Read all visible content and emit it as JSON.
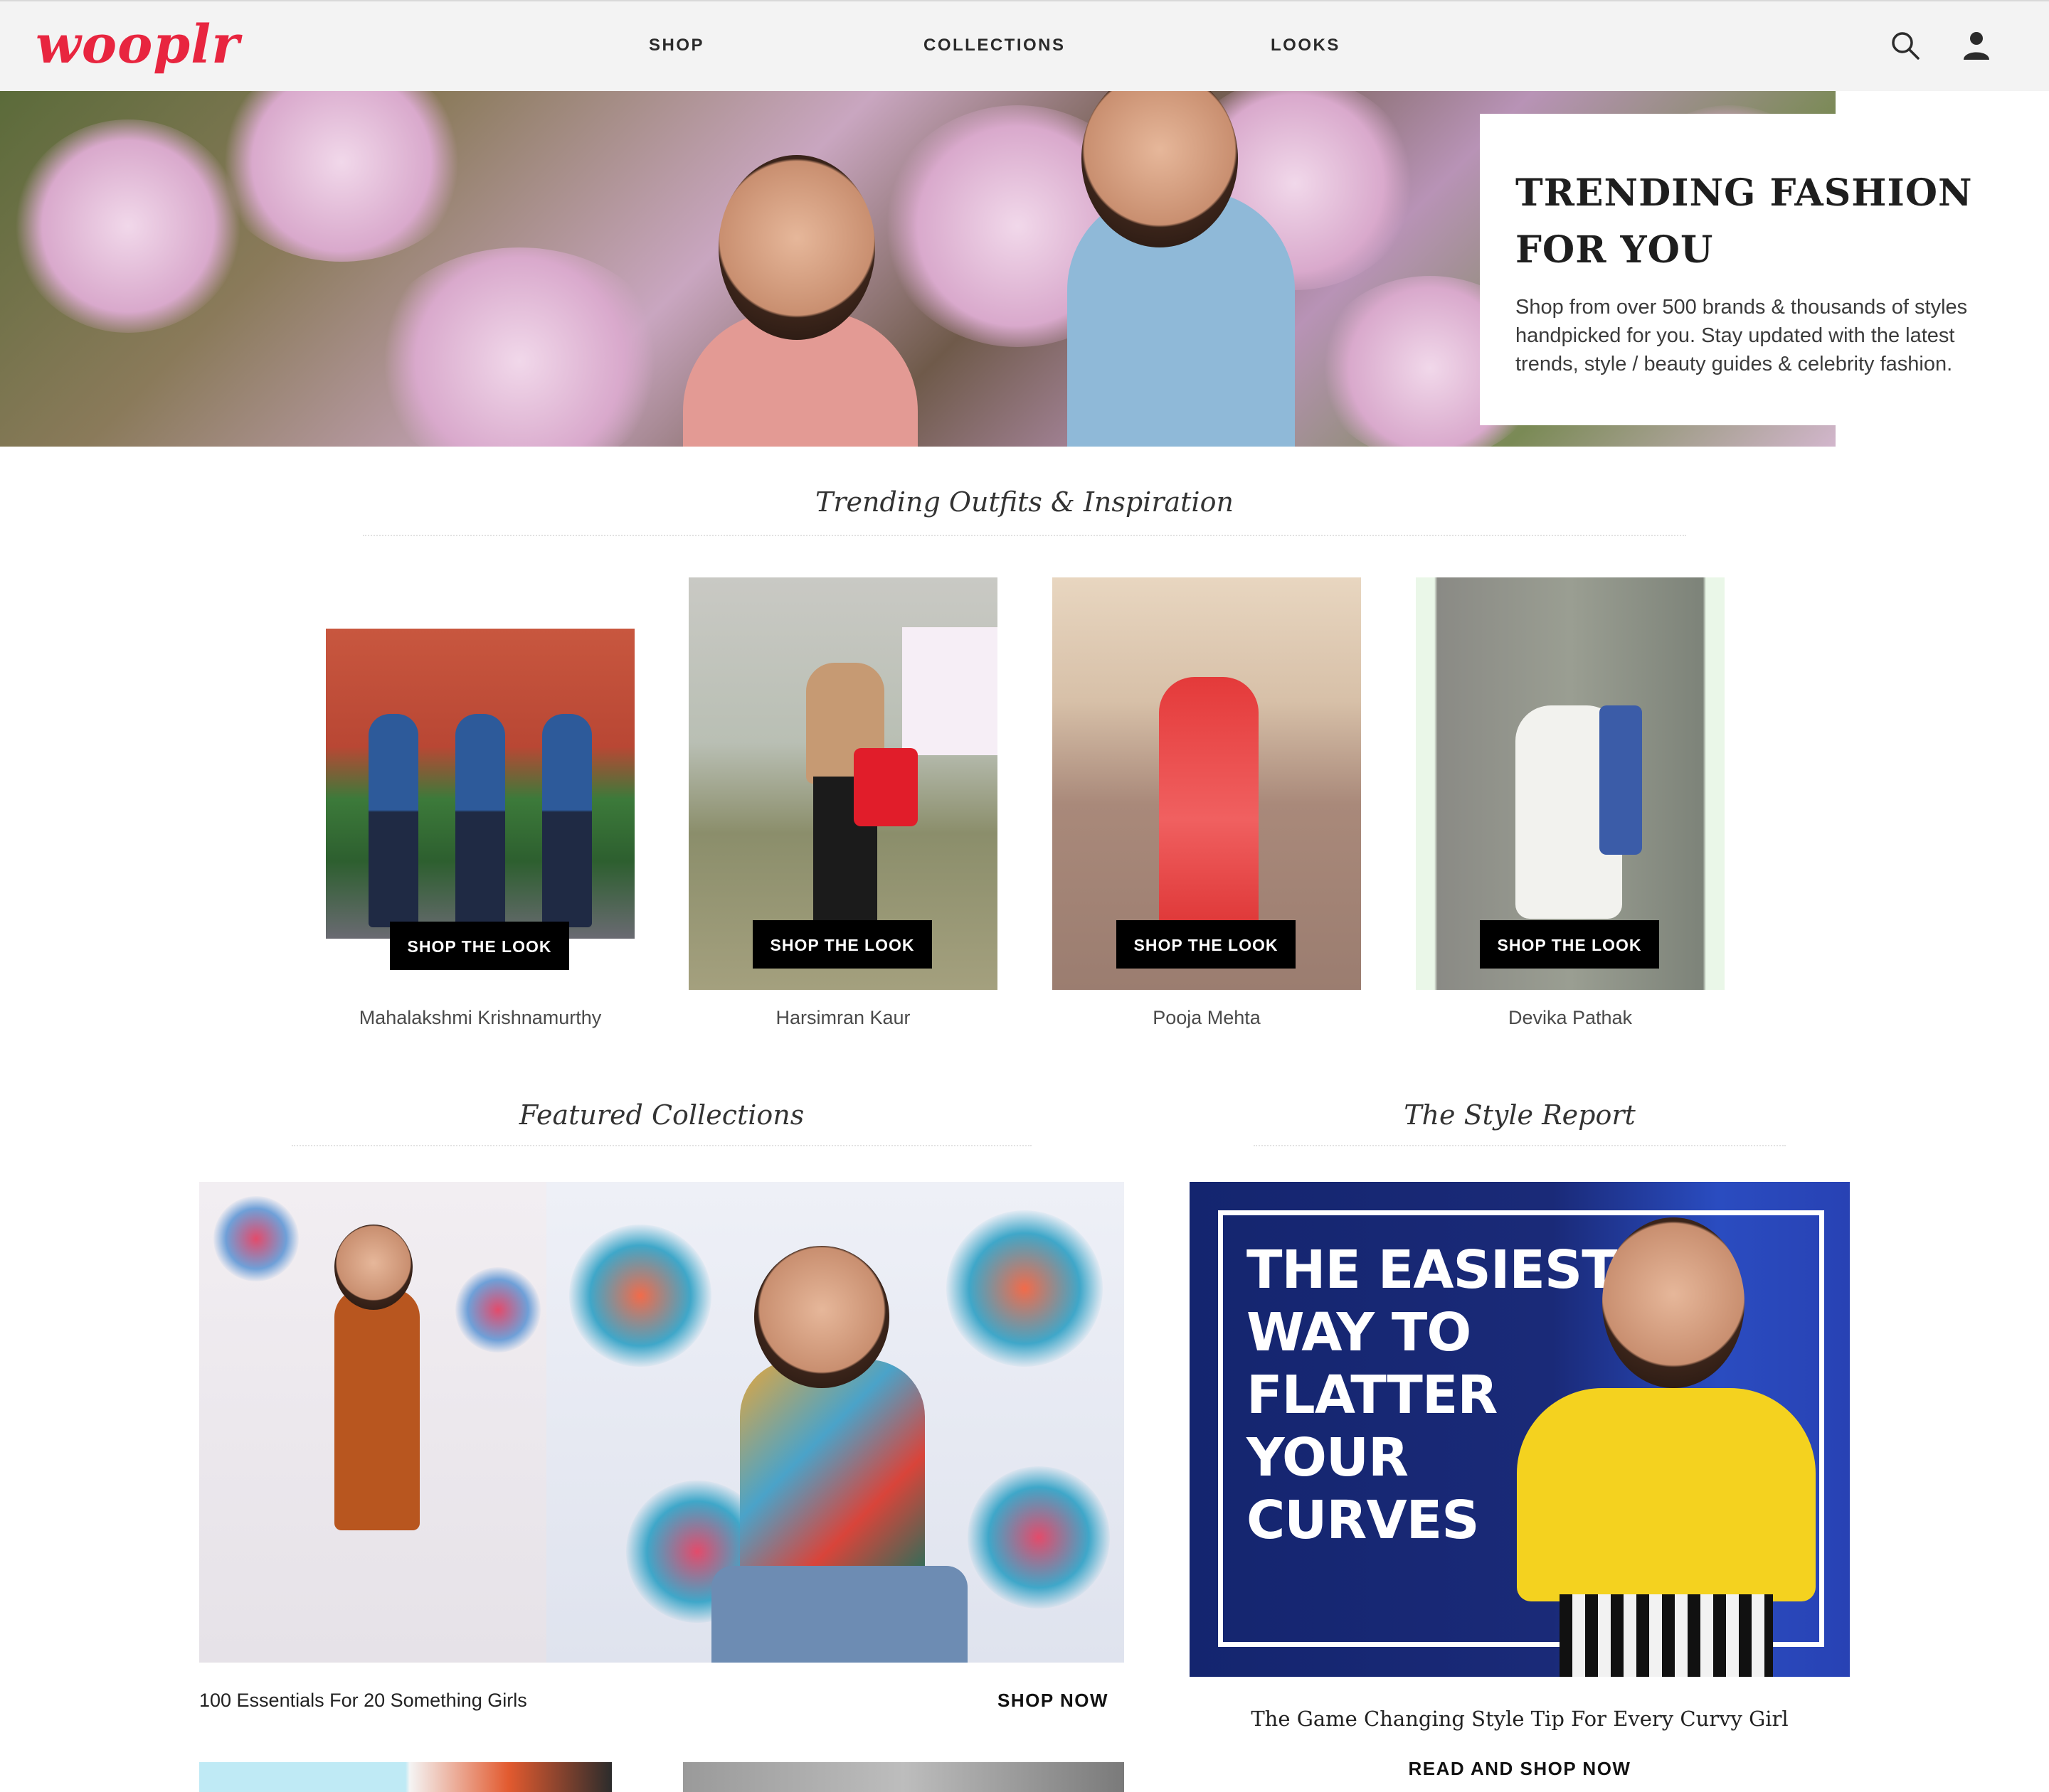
{
  "header": {
    "logo": "wooplr",
    "nav": [
      "SHOP",
      "COLLECTIONS",
      "LOOKS"
    ],
    "icons": [
      "search-icon",
      "user-icon"
    ]
  },
  "hero": {
    "title_line1": "TRENDING FASHION",
    "title_line2": "FOR YOU",
    "subtitle": "Shop from over 500 brands & thousands of styles handpicked for you. Stay updated with the latest trends, style / beauty guides & celebrity fashion."
  },
  "trending": {
    "title": "Trending Outfits & Inspiration",
    "looks": [
      {
        "name": "Mahalakshmi Krishnamurthy",
        "button": "SHOP THE LOOK"
      },
      {
        "name": "Harsimran Kaur",
        "button": "SHOP THE LOOK"
      },
      {
        "name": "Pooja Mehta",
        "button": "SHOP THE LOOK"
      },
      {
        "name": "Devika Pathak",
        "button": "SHOP THE LOOK"
      }
    ]
  },
  "featured": {
    "title": "Featured Collections",
    "caption": "100 Essentials For 20 Something Girls",
    "cta": "SHOP NOW"
  },
  "style_report": {
    "title": "The Style Report",
    "image_text": [
      "THE EASIEST",
      "WAY TO",
      "FLATTER",
      "YOUR",
      "CURVES"
    ],
    "caption": "The Game Changing Style Tip For Every Curvy Girl",
    "cta": "READ AND SHOP NOW"
  },
  "colors": {
    "brand": "#e8253f",
    "header_bg": "#f3f3f3",
    "button_bg": "#000000",
    "style_panel": "#1a2a78"
  }
}
